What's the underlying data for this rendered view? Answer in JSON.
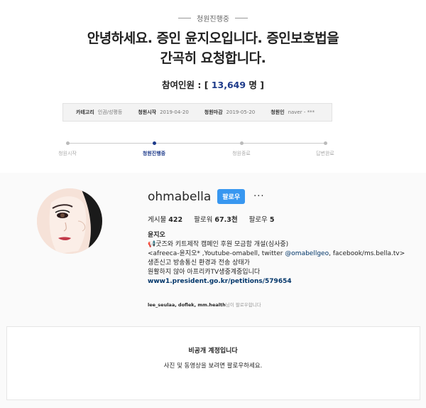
{
  "petition": {
    "status": "청원진행중",
    "title_line1": "안녕하세요. 증인 윤지오입니다. 증인보호법을",
    "title_line2": "간곡히 요청합니다.",
    "participants_label": "참여인원 : [",
    "participants_count": "13,649",
    "participants_suffix": "명 ]",
    "info": [
      {
        "key": "카테고리",
        "value": "인권/성평등"
      },
      {
        "key": "청원시작",
        "value": "2019-04-20"
      },
      {
        "key": "청원마감",
        "value": "2019-05-20"
      },
      {
        "key": "청원인",
        "value": "naver - ***"
      }
    ],
    "steps": [
      {
        "label": "청원시작",
        "active": false
      },
      {
        "label": "청원진행중",
        "active": true
      },
      {
        "label": "청원종료",
        "active": false
      },
      {
        "label": "답변완료",
        "active": false
      }
    ]
  },
  "instagram": {
    "username": "ohmabella",
    "follow_label": "팔로우",
    "more_label": "···",
    "stats": {
      "posts_label": "게시물",
      "posts": "422",
      "followers_label": "팔로워",
      "followers": "67.3천",
      "following_label": "팔로우",
      "following": "5"
    },
    "bio": {
      "name": "윤지오",
      "line1": "📢굿즈와 키트제작 캠페인 후원 모금함 개설(심사중)",
      "line2_a": "<afreeca-윤지오* ,Youtube-omabell, twitter ",
      "line2_mention": "@omabellgeo",
      "line2_b": ", facebook/ms.bella.tv>",
      "line3": "생존신고 방송통신 환경과 전송 상태가",
      "line4": "원활하지 않아 아프리카TV생중계중입니다",
      "link": "www1.president.go.kr/petitions/579654"
    },
    "followed_by_users": "lee_seulaa, doflek, mm.health",
    "followed_by_suffix": "님이 팔로우합니다",
    "private_title": "비공개 계정입니다",
    "private_desc": "사진 및 동영상을 보려면 팔로우하세요."
  }
}
